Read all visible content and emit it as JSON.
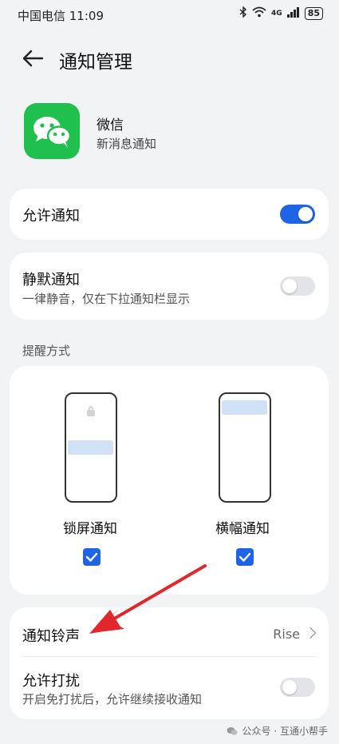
{
  "status_bar": {
    "carrier_time": "中国电信 11:09",
    "network": "4G",
    "battery": "85"
  },
  "header": {
    "title": "通知管理"
  },
  "app": {
    "name": "微信",
    "subtitle": "新消息通知",
    "icon_color": "#1fc04e"
  },
  "allow_notifications": {
    "label": "允许通知",
    "enabled": true
  },
  "silent_notifications": {
    "label": "静默通知",
    "description": "一律静音，仅在下拉通知栏显示",
    "enabled": false
  },
  "reminder_section": {
    "label": "提醒方式",
    "modes": [
      {
        "label": "锁屏通知",
        "checked": true
      },
      {
        "label": "横幅通知",
        "checked": true
      }
    ]
  },
  "ringtone": {
    "label": "通知铃声",
    "value": "Rise"
  },
  "allow_disturb": {
    "label": "允许打扰",
    "description": "开启免打扰后，允许继续接收通知",
    "enabled": false
  },
  "watermark": {
    "text": "公众号 · 互通小帮手"
  },
  "colors": {
    "accent": "#1e64e6",
    "annotation_arrow": "#e0282c",
    "background": "#f1f3f5"
  }
}
